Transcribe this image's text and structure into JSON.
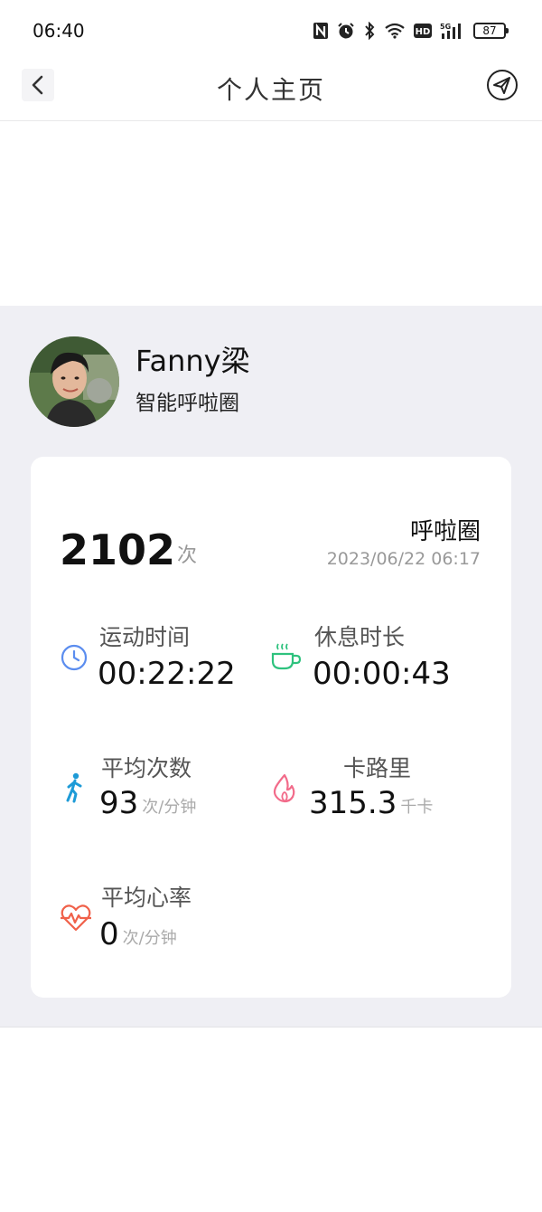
{
  "status_bar": {
    "time": "06:40",
    "battery": "87",
    "icons": [
      "nfc-icon",
      "alarm-icon",
      "bluetooth-icon",
      "wifi-icon",
      "hd-icon",
      "5g-signal-icon",
      "battery-icon"
    ]
  },
  "header": {
    "title": "个人主页",
    "back_icon": "chevron-left-icon",
    "share_icon": "send-icon"
  },
  "profile": {
    "name": "Fanny梁",
    "subtitle": "智能呼啦圈"
  },
  "summary": {
    "count": "2102",
    "count_unit": "次",
    "source": "呼啦圈",
    "date": "2023/06/22 06:17"
  },
  "stats": [
    {
      "label": "运动时间",
      "value": "00:22:22",
      "unit": "",
      "icon": "clock-icon",
      "color": "#5b8def"
    },
    {
      "label": "休息时长",
      "value": "00:00:43",
      "unit": "",
      "icon": "coffee-cup-icon",
      "color": "#2ec27e"
    },
    {
      "label": "平均次数",
      "value": "93",
      "unit": "次/分钟",
      "icon": "walking-person-icon",
      "color": "#1e9bd7"
    },
    {
      "label": "卡路里",
      "value": "315.3",
      "unit": "千卡",
      "icon": "flame-icon",
      "color": "#f26b8a"
    },
    {
      "label": "平均心率",
      "value": "0",
      "unit": "次/分钟",
      "icon": "heart-rate-icon",
      "color": "#f0614a"
    }
  ]
}
